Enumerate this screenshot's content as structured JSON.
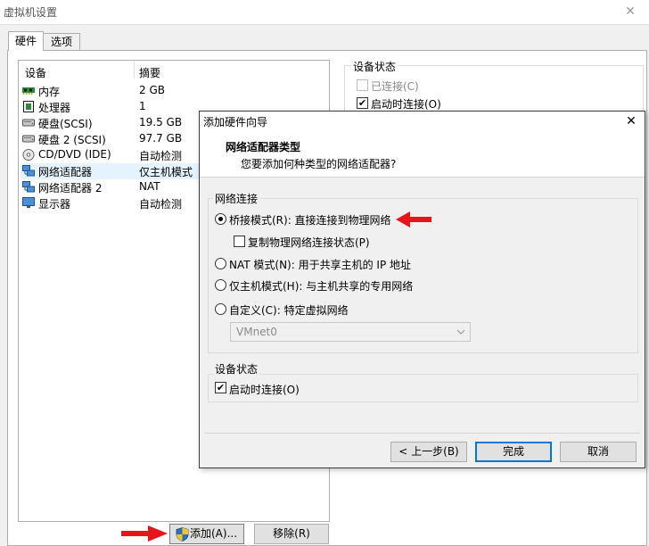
{
  "outer_window": {
    "title": "虚拟机设置",
    "close_glyph": "✕"
  },
  "tabs": [
    {
      "label": "硬件",
      "selected": true
    },
    {
      "label": "选项",
      "selected": false
    }
  ],
  "device_list": {
    "headers": {
      "device": "设备",
      "summary": "摘要"
    },
    "rows": [
      {
        "name": "内存",
        "summary": "2 GB",
        "icon": "memory-icon"
      },
      {
        "name": "处理器",
        "summary": "1",
        "icon": "processor-icon"
      },
      {
        "name": "硬盘(SCSI)",
        "summary": "19.5 GB",
        "icon": "hard-disk-icon"
      },
      {
        "name": "硬盘 2 (SCSI)",
        "summary": "97.7 GB",
        "icon": "hard-disk-icon"
      },
      {
        "name": "CD/DVD (IDE)",
        "summary": "自动检测",
        "icon": "cd-dvd-icon"
      },
      {
        "name": "网络适配器",
        "summary": "仅主机模式",
        "icon": "network-adapter-icon",
        "selected": true
      },
      {
        "name": "网络适配器 2",
        "summary": "NAT",
        "icon": "network-adapter-icon"
      },
      {
        "name": "显示器",
        "summary": "自动检测",
        "icon": "display-icon"
      }
    ]
  },
  "device_status": {
    "title": "设备状态",
    "connected_label": "已连接(C)",
    "connected_checked": false,
    "poweron_label": "启动时连接(O)",
    "poweron_checked": true
  },
  "bottom_buttons": {
    "add_label": "添加(A)...",
    "remove_label": "移除(R)"
  },
  "dialog": {
    "title": "添加硬件向导",
    "heading": "网络适配器类型",
    "subheading": "您要添加何种类型的网络适配器?",
    "network_group_title": "网络连接",
    "options": {
      "bridged": "桥接模式(R): 直接连接到物理网络",
      "replicate": "复制物理网络连接状态(P)",
      "nat": "NAT 模式(N): 用于共享主机的 IP 地址",
      "host_only": "仅主机模式(H): 与主机共享的专用网络",
      "custom": "自定义(C): 特定虚拟网络"
    },
    "selected_option": "bridged",
    "vmnet_value": "VMnet0",
    "device_status_title": "设备状态",
    "poweron_label": "启动时连接(O)",
    "poweron_checked": true,
    "back_label": "< 上一步(B)",
    "finish_label": "完成",
    "cancel_label": "取消"
  },
  "colors": {
    "selection": "#e5f3ff",
    "default_button_border": "#0078d7",
    "annotation_arrow": "#e8141c"
  }
}
